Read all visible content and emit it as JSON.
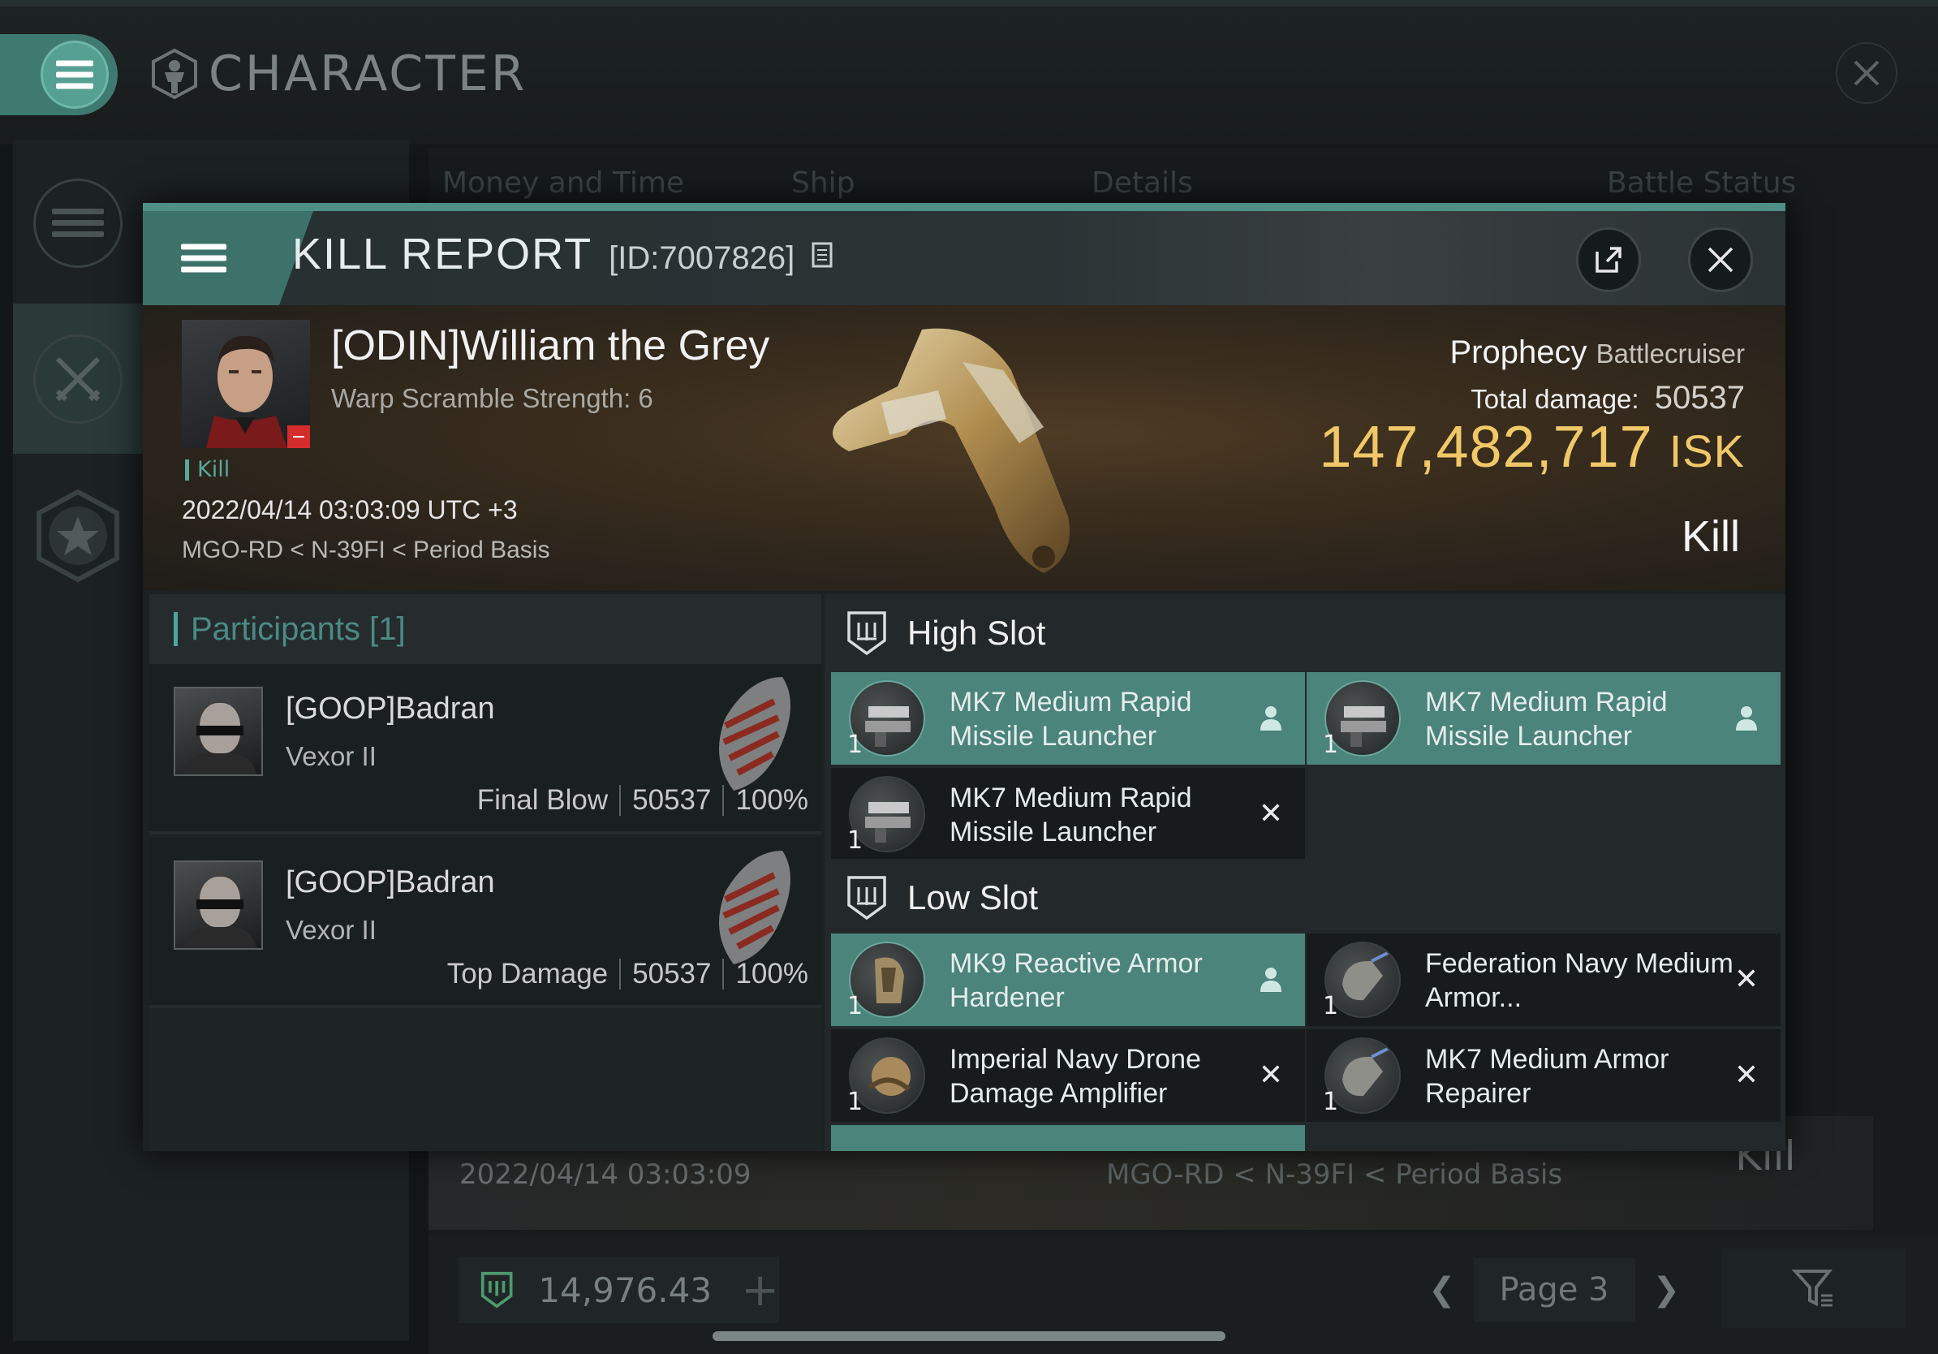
{
  "app": {
    "title": "CHARACTER"
  },
  "background": {
    "tabs": [
      "Money and Time",
      "Ship",
      "Details",
      "Battle Status"
    ],
    "row": {
      "date": "2022/04/14  03:03:09",
      "location": "MGO-RD < N-39FI < Period Basis",
      "status": "Kill"
    },
    "balance": "14,976.43",
    "page_label": "Page 3"
  },
  "kill_report": {
    "title": "KILL REPORT",
    "id_text": "[ID:7007826]",
    "victim": {
      "name": "[ODIN]William the Grey",
      "warp_scramble": "Warp Scramble Strength: 6",
      "tag": "Kill",
      "datetime": "2022/04/14 03:03:09 UTC +3",
      "location": "MGO-RD < N-39FI < Period Basis"
    },
    "ship": {
      "name": "Prophecy",
      "class": "Battlecruiser"
    },
    "total_damage_label": "Total damage:",
    "total_damage": "50537",
    "isk_value": "147,482,717",
    "isk_unit": "ISK",
    "result": "Kill",
    "participants": {
      "label": "Participants [1]",
      "rows": [
        {
          "name": "[GOOP]Badran",
          "ship": "Vexor II",
          "role": "Final Blow",
          "damage": "50537",
          "percent": "100%"
        },
        {
          "name": "[GOOP]Badran",
          "ship": "Vexor II",
          "role": "Top Damage",
          "damage": "50537",
          "percent": "100%"
        }
      ]
    },
    "high_slot": {
      "label": "High Slot",
      "modules": [
        {
          "qty": "1",
          "name": "MK7 Medium Rapid Missile Launcher",
          "state": "person-icon"
        },
        {
          "qty": "1",
          "name": "MK7 Medium Rapid Missile Launcher",
          "state": "person-icon"
        },
        {
          "qty": "1",
          "name": "MK7 Medium Rapid Missile Launcher",
          "state": "close-icon"
        }
      ]
    },
    "low_slot": {
      "label": "Low Slot",
      "modules": [
        {
          "qty": "1",
          "name": "MK9 Reactive Armor Hardener",
          "state": "person-icon"
        },
        {
          "qty": "1",
          "name": "Federation Navy Medium Armor...",
          "state": "close-icon"
        },
        {
          "qty": "1",
          "name": "Imperial Navy Drone Damage Amplifier",
          "state": "close-icon"
        },
        {
          "qty": "1",
          "name": "MK7 Medium Armor Repairer",
          "state": "close-icon"
        }
      ]
    }
  },
  "colors": {
    "accent": "#4a847a",
    "isk": "#f1c868",
    "participants_label": "#4a8b84"
  }
}
